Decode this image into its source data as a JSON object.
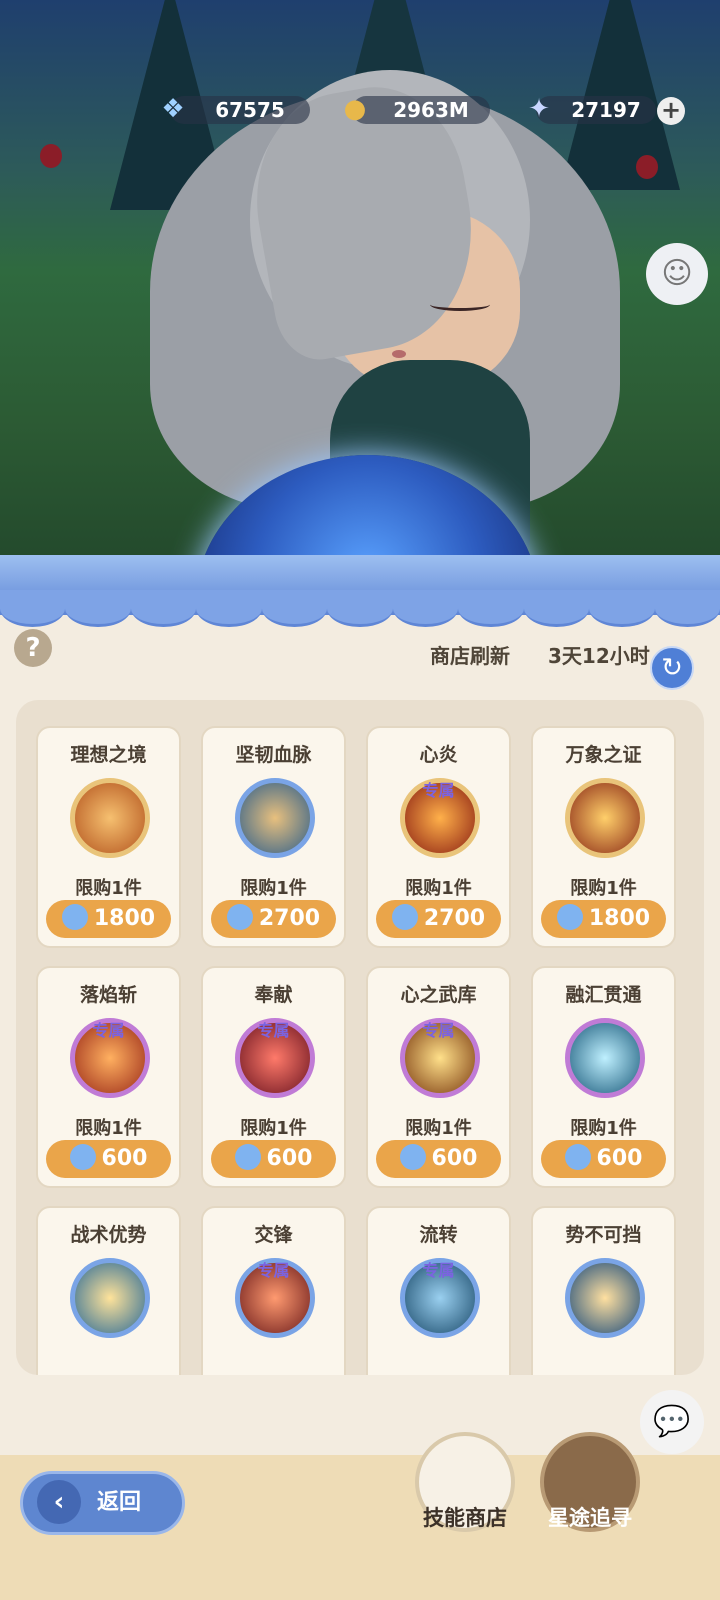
{
  "resources": [
    {
      "icon": "blue-crystal-icon",
      "value": "67575"
    },
    {
      "icon": "gold-coin-icon",
      "value": "2963M"
    },
    {
      "icon": "star-crystal-icon",
      "value": "27197"
    }
  ],
  "shop": {
    "refresh_label": "商店刷新",
    "refresh_time": "3天12小时"
  },
  "items": [
    {
      "name": "理想之境",
      "exclusive": "",
      "limit": "限购1件",
      "price": "1800"
    },
    {
      "name": "坚韧血脉",
      "exclusive": "",
      "limit": "限购1件",
      "price": "2700"
    },
    {
      "name": "心炎",
      "exclusive": "专属",
      "limit": "限购1件",
      "price": "2700"
    },
    {
      "name": "万象之证",
      "exclusive": "",
      "limit": "限购1件",
      "price": "1800"
    },
    {
      "name": "落焰斩",
      "exclusive": "专属",
      "limit": "限购1件",
      "price": "600"
    },
    {
      "name": "奉献",
      "exclusive": "专属",
      "limit": "限购1件",
      "price": "600"
    },
    {
      "name": "心之武库",
      "exclusive": "专属",
      "limit": "限购1件",
      "price": "600"
    },
    {
      "name": "融汇贯通",
      "exclusive": "",
      "limit": "限购1件",
      "price": "600"
    },
    {
      "name": "战术优势",
      "exclusive": "",
      "limit": "",
      "price": ""
    },
    {
      "name": "交锋",
      "exclusive": "专属",
      "limit": "",
      "price": ""
    },
    {
      "name": "流转",
      "exclusive": "专属",
      "limit": "",
      "price": ""
    },
    {
      "name": "势不可挡",
      "exclusive": "",
      "limit": "",
      "price": ""
    }
  ],
  "nav": {
    "back_label": "返回",
    "skill_shop_label": "技能商店",
    "star_path_label": "星途追寻"
  },
  "colors": {
    "price_button": "#eaa54a",
    "awning": "#7ea3e6",
    "exclusive_text": "#7b63e0"
  }
}
